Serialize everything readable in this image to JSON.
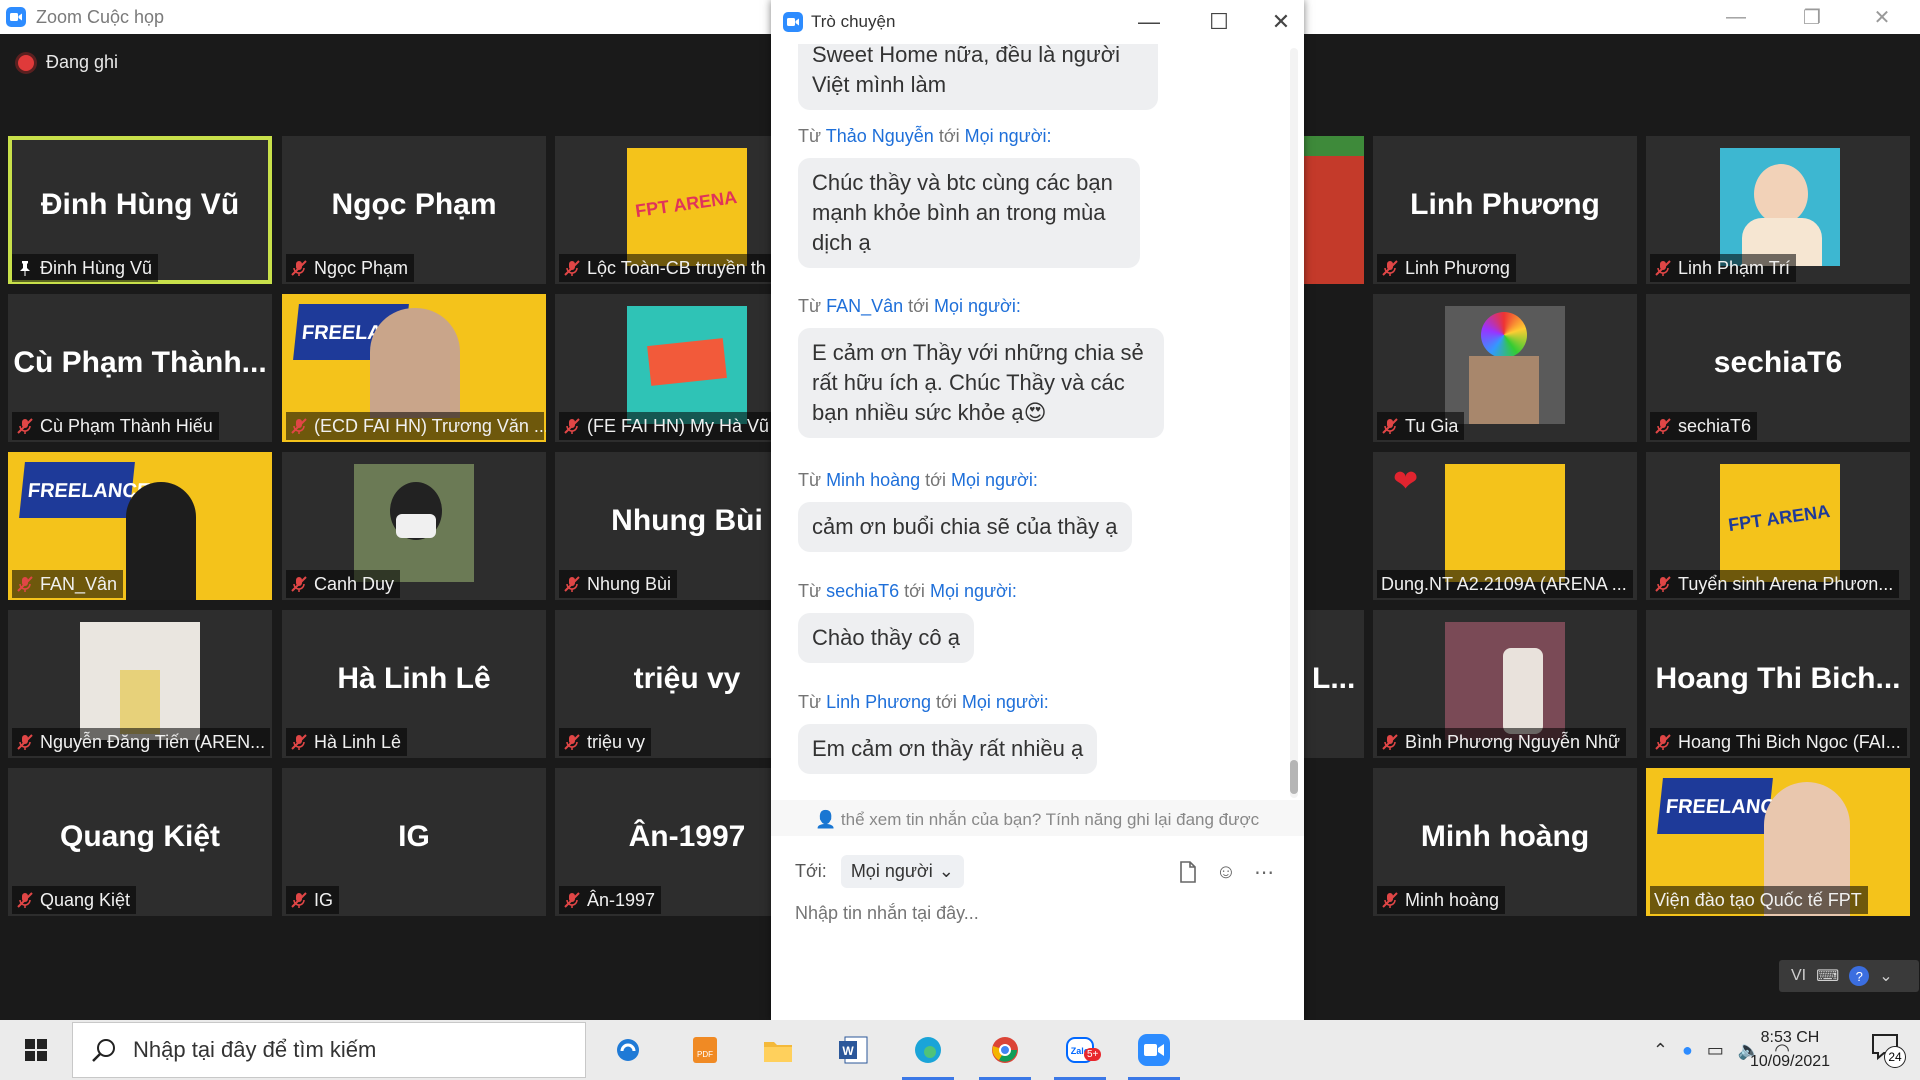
{
  "window": {
    "title": "Zoom Cuộc họp",
    "recording_label": "Đang ghi"
  },
  "participants": [
    {
      "big": "Đinh Hùng Vũ",
      "tag": "Đinh Hùng Vũ",
      "pinned": true
    },
    {
      "big": "Ngọc Phạm",
      "tag": "Ngọc Phạm"
    },
    {
      "big": "",
      "tag": "Lộc Toàn-CB truyền th"
    },
    {
      "big": "Linh Phương",
      "tag": "Linh Phương"
    },
    {
      "big": "",
      "tag": "Linh Phạm Trí"
    },
    {
      "big": "Cù Phạm Thành...",
      "tag": "Cù Phạm Thành Hiếu"
    },
    {
      "big": "",
      "tag": "(ECD FAI HN) Trương Văn ..."
    },
    {
      "big": "",
      "tag": "(FE FAI HN) My Hà Vũ"
    },
    {
      "big": "",
      "tag": "Tu Gia"
    },
    {
      "big": "sechiaT6",
      "tag": "sechiaT6"
    },
    {
      "big": "",
      "tag": "FAN_Vân"
    },
    {
      "big": "",
      "tag": "Canh Duy"
    },
    {
      "big": "Nhung Bùi",
      "tag": "Nhung Bùi"
    },
    {
      "big": "",
      "tag": "Dung.NT A2.2109A (ARENA ..."
    },
    {
      "big": "",
      "tag": "Tuyển sinh Arena Phươn..."
    },
    {
      "big": "",
      "tag": "Nguyễn Đăng Tiến (AREN..."
    },
    {
      "big": "Hà Linh Lê",
      "tag": "Hà Linh Lê"
    },
    {
      "big": "triệu vy",
      "tag": "triệu vy"
    },
    {
      "big": "",
      "tag": "Bình Phương Nguyễn Nhữ"
    },
    {
      "big": "Hoang Thi Bich...",
      "tag": "Hoang Thi Bich Ngoc (FAI..."
    },
    {
      "big": "Quang Kiệt",
      "tag": "Quang Kiệt"
    },
    {
      "big": "IG",
      "tag": "IG"
    },
    {
      "big": "Ân-1997",
      "tag": "Ân-1997"
    },
    {
      "big": "Minh hoàng",
      "tag": "Minh hoàng"
    },
    {
      "big": "",
      "tag": "Viện đào tạo Quốc tế FPT"
    }
  ],
  "partial_tile": {
    "big": "L..."
  },
  "chat": {
    "title": "Trò chuyện",
    "from_word": "Từ",
    "to_word": "tới",
    "everyone": "Mọi người:",
    "prev_bubble": "Sweet Home nữa, đều là người\nViệt mình làm",
    "messages": [
      {
        "sender": "Thảo Nguyễn",
        "text": "Chúc thầy và btc cùng các bạn\nmạnh khỏe bình an trong mùa\ndịch ạ"
      },
      {
        "sender": "FAN_Vân",
        "text": "E cảm ơn Thầy với những chia sẻ\nrất hữu ích ạ. Chúc Thầy và các\nbạn nhiều sức khỏe ạ😍"
      },
      {
        "sender": "Minh hoàng",
        "text": "cảm ơn buổi chia sẽ của thầy ạ"
      },
      {
        "sender": "sechiaT6",
        "text": "Chào thầy cô ạ"
      },
      {
        "sender": "Linh Phương",
        "text": "Em cảm ơn thầy rất nhiều ạ"
      }
    ],
    "recording_notice": "thể xem tin nhắn của bạn? Tính năng ghi lại đang được",
    "to_label": "Tới:",
    "to_value": "Mọi người",
    "input_placeholder": "Nhập tin nhắn tại đây..."
  },
  "lang_indicator": "VI",
  "taskbar": {
    "search_placeholder": "Nhập tại đây để tìm kiếm",
    "time": "8:53 CH",
    "date": "10/09/2021",
    "notification_count": "24",
    "zalo_badge": "5+"
  }
}
